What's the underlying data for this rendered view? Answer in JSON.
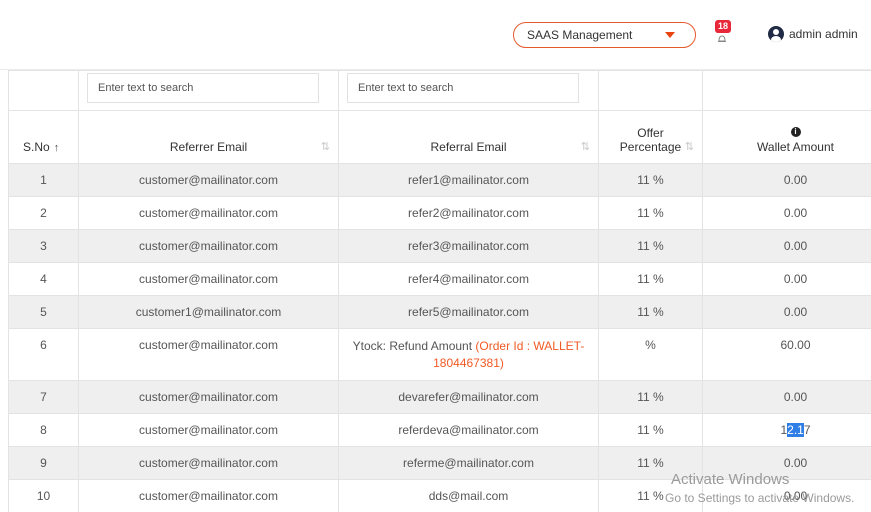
{
  "header": {
    "module_select": "SAAS Management",
    "notification_count": "18",
    "user_name": "admin admin"
  },
  "filters": {
    "referrer_placeholder": "Enter text to search",
    "referral_placeholder": "Enter text to search"
  },
  "columns": {
    "sno": "S.No",
    "referrer": "Referrer Email",
    "referral": "Referral Email",
    "offer_line1": "Offer",
    "offer_line2": "Percentage",
    "wallet": "Wallet Amount",
    "sort_asc": "↑",
    "sort_both": "⇅"
  },
  "rows": [
    {
      "sno": "1",
      "referrer": "customer@mailinator.com",
      "referral": "refer1@mailinator.com",
      "offer": "11 %",
      "wallet": "0.00"
    },
    {
      "sno": "2",
      "referrer": "customer@mailinator.com",
      "referral": "refer2@mailinator.com",
      "offer": "11 %",
      "wallet": "0.00"
    },
    {
      "sno": "3",
      "referrer": "customer@mailinator.com",
      "referral": "refer3@mailinator.com",
      "offer": "11 %",
      "wallet": "0.00"
    },
    {
      "sno": "4",
      "referrer": "customer@mailinator.com",
      "referral": "refer4@mailinator.com",
      "offer": "11 %",
      "wallet": "0.00"
    },
    {
      "sno": "5",
      "referrer": "customer1@mailinator.com",
      "referral": "refer5@mailinator.com",
      "offer": "11 %",
      "wallet": "0.00"
    },
    {
      "sno": "6",
      "referrer": "customer@mailinator.com",
      "referral_prefix": "Ytock: Refund Amount ",
      "referral_order": "(Order Id : WALLET-1804467381)",
      "offer": "%",
      "wallet": "60.00"
    },
    {
      "sno": "7",
      "referrer": "customer@mailinator.com",
      "referral": "devarefer@mailinator.com",
      "offer": "11 %",
      "wallet": "0.00"
    },
    {
      "sno": "8",
      "referrer": "customer@mailinator.com",
      "referral": "referdeva@mailinator.com",
      "offer": "11 %",
      "wallet_pre": "1",
      "wallet_sel": "2.1",
      "wallet_post": "7"
    },
    {
      "sno": "9",
      "referrer": "customer@mailinator.com",
      "referral": "referme@mailinator.com",
      "offer": "11 %",
      "wallet": "0.00"
    },
    {
      "sno": "10",
      "referrer": "customer@mailinator.com",
      "referral": "dds@mail.com",
      "offer": "11 %",
      "wallet": "0.00"
    }
  ],
  "watermark": {
    "title": "Activate Windows",
    "subtitle": "Go to Settings to activate Windows."
  }
}
